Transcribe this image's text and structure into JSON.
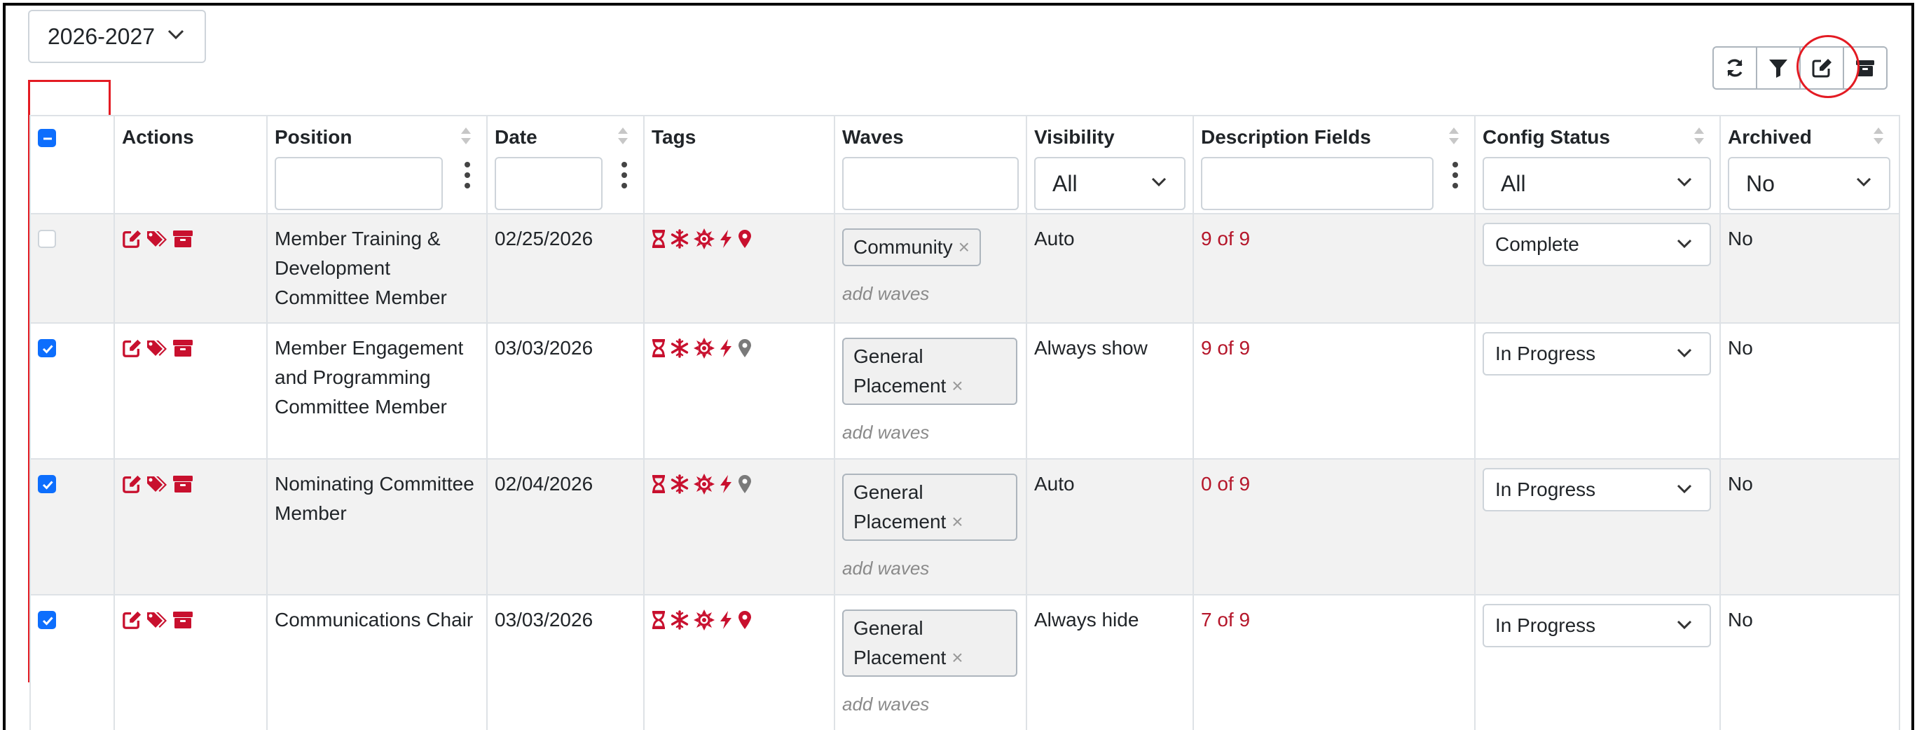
{
  "year_selector": {
    "value": "2026-2027"
  },
  "toolbar": {
    "buttons": [
      {
        "name": "refresh-icon"
      },
      {
        "name": "filter-icon"
      },
      {
        "name": "edit-icon"
      },
      {
        "name": "archive-icon"
      }
    ]
  },
  "columns": {
    "actions": "Actions",
    "position": "Position",
    "date": "Date",
    "tags": "Tags",
    "waves": "Waves",
    "visibility": "Visibility",
    "description_fields": "Description Fields",
    "config_status": "Config Status",
    "archived": "Archived"
  },
  "filters": {
    "visibility": "All",
    "config_status": "All",
    "archived": "No"
  },
  "add_waves_placeholder": "add waves",
  "rows": [
    {
      "checked": false,
      "position": "Member Training & Development Committee Member",
      "date": "02/25/2026",
      "location_active": true,
      "wave": "Community",
      "visibility": "Auto",
      "description_fields": "9 of 9",
      "config_status": "Complete",
      "archived": "No"
    },
    {
      "checked": true,
      "position": "Member Engagement and Programming Committee Member",
      "date": "03/03/2026",
      "location_active": false,
      "wave": "General Placement",
      "visibility": "Always show",
      "description_fields": "9 of 9",
      "config_status": "In Progress",
      "archived": "No"
    },
    {
      "checked": true,
      "position": "Nominating Committee Member",
      "date": "02/04/2026",
      "location_active": false,
      "wave": "General Placement",
      "visibility": "Auto",
      "description_fields": "0 of 9",
      "config_status": "In Progress",
      "archived": "No"
    },
    {
      "checked": true,
      "position": "Communications Chair",
      "date": "03/03/2026",
      "location_active": true,
      "wave": "General Placement",
      "visibility": "Always hide",
      "description_fields": "7 of 9",
      "config_status": "In Progress",
      "archived": "No"
    }
  ],
  "colors": {
    "accent_red": "#c8102e",
    "desc_red": "#b5162a",
    "checkbox_blue": "#0d6efd",
    "highlight_red": "#e31b23",
    "inactive_gray": "#7a7a7a"
  }
}
